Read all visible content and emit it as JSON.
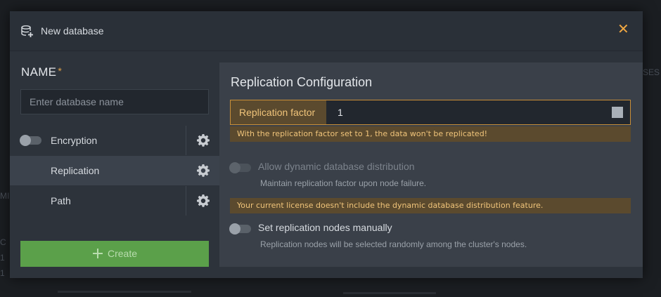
{
  "background": {
    "fragments": [
      "SES",
      "MI",
      "C",
      "1",
      "1"
    ]
  },
  "dialog": {
    "title": "New database",
    "close_glyph": "✕"
  },
  "left": {
    "name_label": "NAME",
    "required_mark": "*",
    "name_placeholder": "Enter database name",
    "name_value": "",
    "options": [
      {
        "label": "Encryption",
        "toggle": false
      },
      {
        "label": "Replication",
        "active": true
      },
      {
        "label": "Path"
      }
    ],
    "create_label": "Create"
  },
  "replication": {
    "title": "Replication Configuration",
    "factor_label": "Replication factor",
    "factor_value": "1",
    "factor_warning": "With the replication factor set to 1, the data won't be replicated!",
    "dynamic_label": "Allow dynamic database distribution",
    "dynamic_help": "Maintain replication factor upon node failure.",
    "dynamic_enabled": false,
    "license_warning": "Your current license doesn't include the dynamic database distribution feature.",
    "manual_label": "Set replication nodes manually",
    "manual_help": "Replication nodes will be selected randomly among the cluster's nodes.",
    "manual_enabled": false
  },
  "colors": {
    "accent_warning": "#f0c47a",
    "create_green": "#5ba04a",
    "close_orange": "#f0a742"
  },
  "icons": [
    "database-add-icon",
    "close-icon",
    "gear-icon",
    "plus-icon",
    "toggle-switch"
  ]
}
